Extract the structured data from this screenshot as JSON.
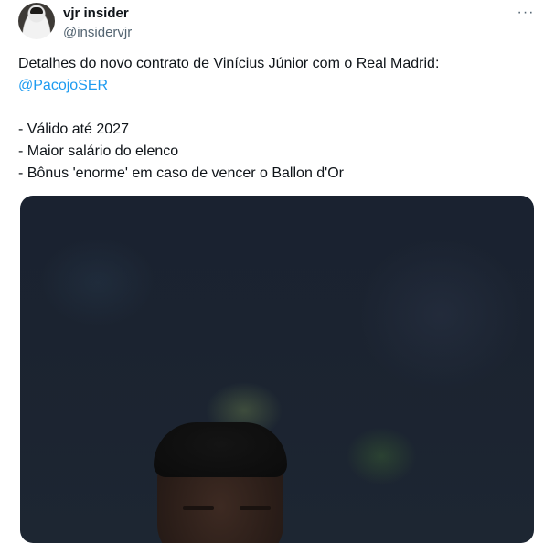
{
  "author": {
    "name": "vjr insider",
    "handle": "@insidervjr",
    "avatar_icon": "profile-avatar"
  },
  "menu": {
    "more_label": "···"
  },
  "tweet": {
    "line1": "Detalhes do novo contrato de Vinícius Júnior com o Real Madrid:",
    "mention": "@PacojoSER",
    "bullets": [
      "- Válido até 2027",
      "- Maior salário do elenco",
      "- Bônus 'enorme' em caso de vencer o Ballon d'Or"
    ]
  },
  "colors": {
    "text": "#0f1419",
    "secondary": "#536471",
    "link": "#1d9bf0"
  }
}
